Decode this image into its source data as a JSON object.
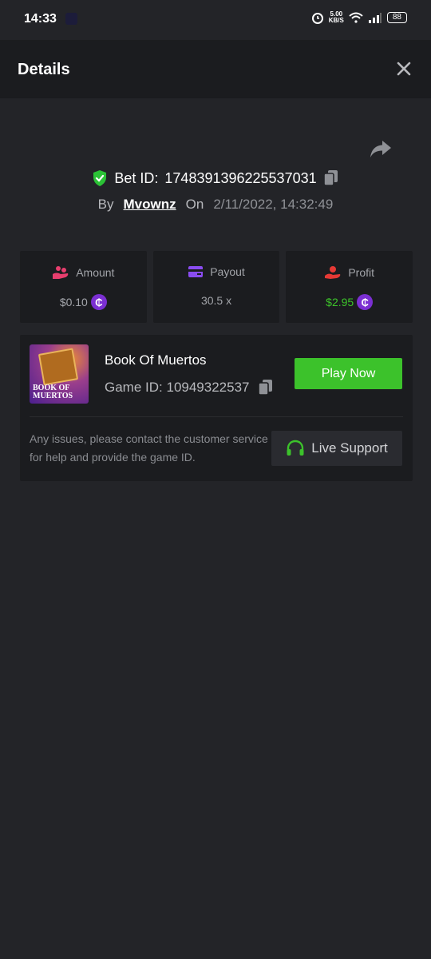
{
  "status_bar": {
    "time": "14:33",
    "speed_value": "5.00",
    "speed_unit": "KB/S",
    "battery": "88"
  },
  "header": {
    "title": "Details"
  },
  "bet": {
    "id_label": "Bet ID:",
    "id_value": "1748391396225537031",
    "by_label": "By",
    "username": "Mvownz",
    "on_label": "On",
    "date": "2/11/2022, 14:32:49"
  },
  "stats": {
    "amount_label": "Amount",
    "amount_value": "$0.10",
    "payout_label": "Payout",
    "payout_value": "30.5 x",
    "profit_label": "Profit",
    "profit_value": "$2.95",
    "coin_symbol": "₵"
  },
  "game": {
    "thumb_text_line1": "BOOK OF",
    "thumb_text_line2": "MUERTOS",
    "name": "Book Of Muertos",
    "id_label": "Game ID:",
    "id_value": "10949322537",
    "play_label": "Play Now",
    "help_text": "Any issues, please contact the customer service for help and provide the game ID.",
    "support_label": "Live Support"
  },
  "colors": {
    "background": "#232428",
    "card": "#1b1c1f",
    "accent_green": "#3cc22b",
    "coin_purple": "#7b2fd2",
    "amount_icon": "#e83e6e",
    "payout_icon": "#8a4cf0",
    "profit_icon": "#e53935"
  },
  "icons": {
    "close": "close-icon",
    "share": "share-icon",
    "shield": "shield-check-icon",
    "copy": "copy-icon",
    "amount": "coins-hand-icon",
    "payout": "card-icon",
    "profit": "hand-coin-icon",
    "support": "headset-icon"
  }
}
